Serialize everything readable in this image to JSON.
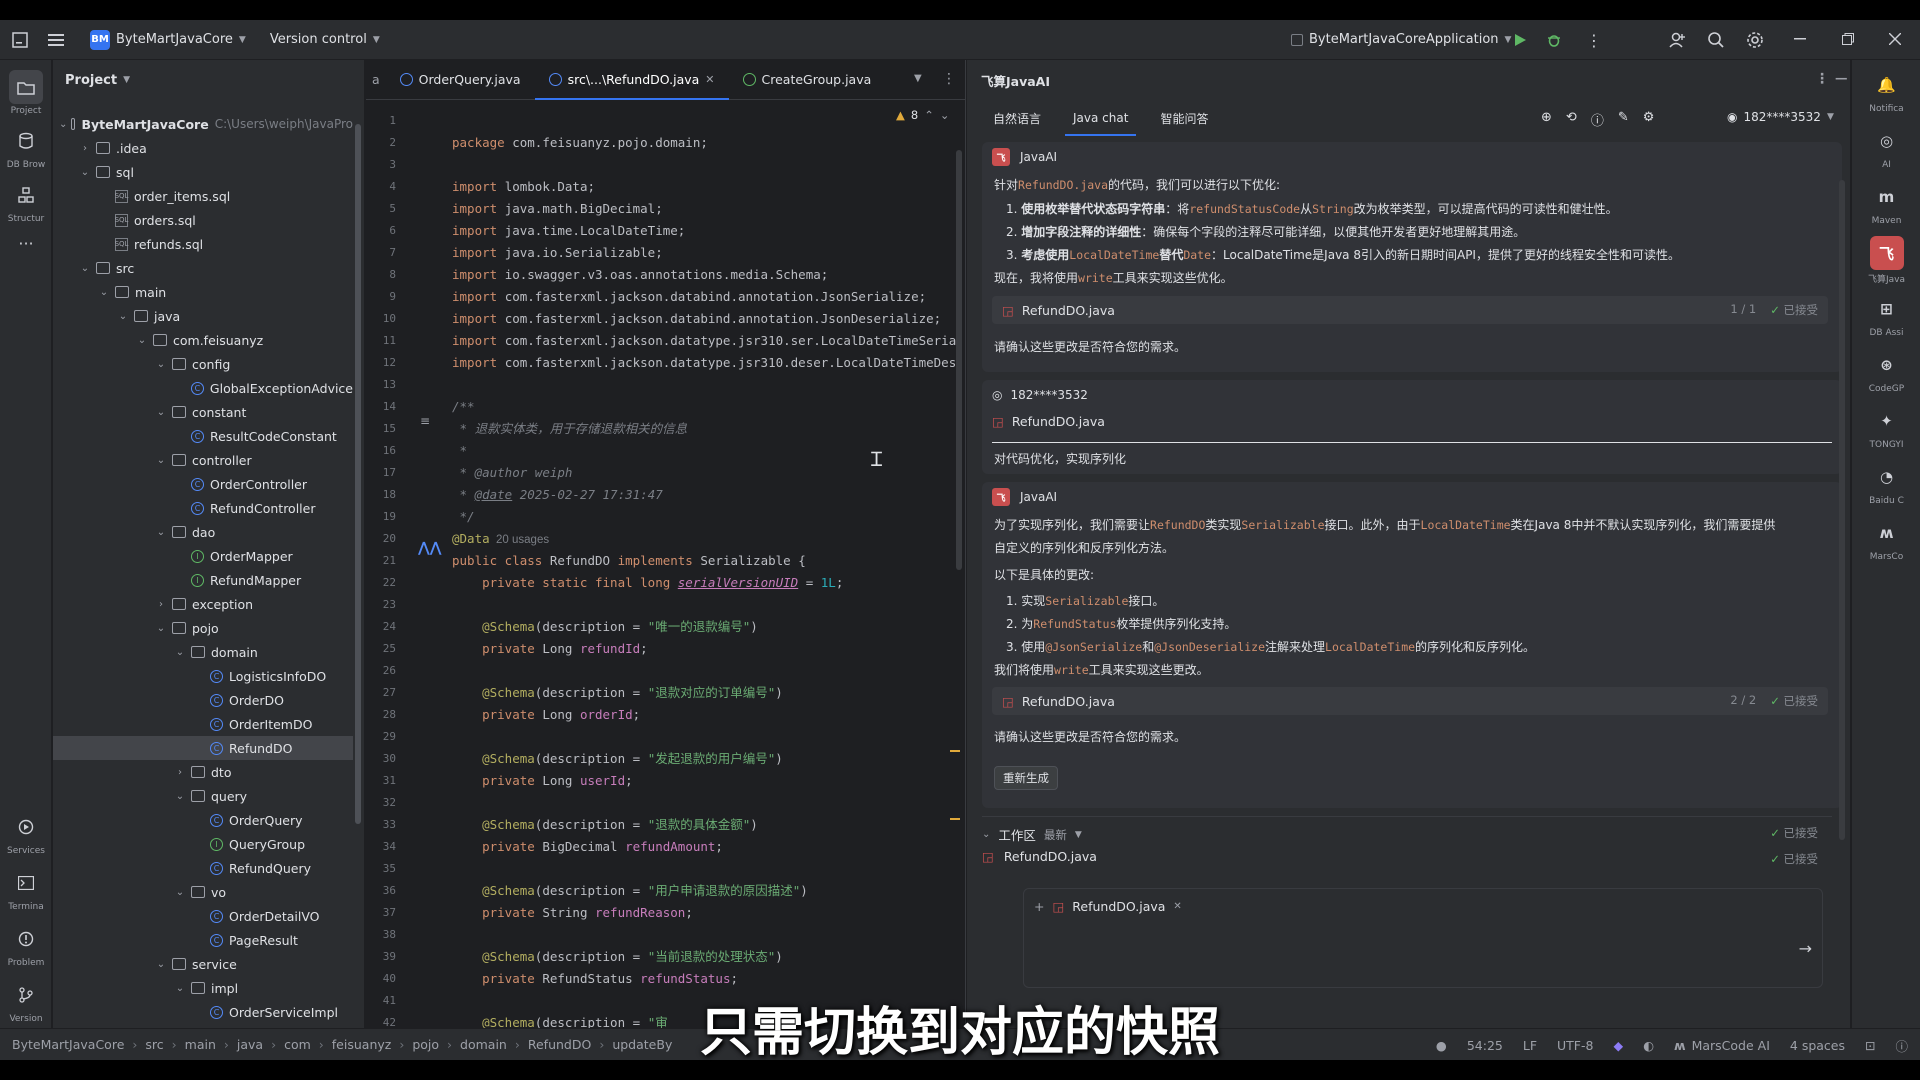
{
  "titlebar": {
    "project_badge": "BM",
    "project_name": "ByteMartJavaCore",
    "vcs": "Version control",
    "run_config": "ByteMartJavaCoreApplication"
  },
  "left_strip": {
    "top": [
      "Project",
      "DB Brow",
      "Structur"
    ],
    "bottom": [
      "Services",
      "Termina",
      "Problem",
      "Version"
    ]
  },
  "project_panel": {
    "title": "Project",
    "tree": [
      {
        "label": "ByteMartJavaCore",
        "path": "C:\\Users\\weiph\\JavaPro",
        "level": 0,
        "type": "folder",
        "open": true,
        "bold": true
      },
      {
        "label": ".idea",
        "level": 1,
        "type": "folder",
        "open": false
      },
      {
        "label": "sql",
        "level": 1,
        "type": "folder",
        "open": true
      },
      {
        "label": "order_items.sql",
        "level": 2,
        "type": "sql"
      },
      {
        "label": "orders.sql",
        "level": 2,
        "type": "sql"
      },
      {
        "label": "refunds.sql",
        "level": 2,
        "type": "sql"
      },
      {
        "label": "src",
        "level": 1,
        "type": "folder",
        "open": true
      },
      {
        "label": "main",
        "level": 2,
        "type": "folder",
        "open": true
      },
      {
        "label": "java",
        "level": 3,
        "type": "folder",
        "open": true
      },
      {
        "label": "com.feisuanyz",
        "level": 4,
        "type": "folder",
        "open": true
      },
      {
        "label": "config",
        "level": 5,
        "type": "folder",
        "open": true
      },
      {
        "label": "GlobalExceptionAdvice",
        "level": 6,
        "type": "class"
      },
      {
        "label": "constant",
        "level": 5,
        "type": "folder",
        "open": true
      },
      {
        "label": "ResultCodeConstant",
        "level": 6,
        "type": "class"
      },
      {
        "label": "controller",
        "level": 5,
        "type": "folder",
        "open": true
      },
      {
        "label": "OrderController",
        "level": 6,
        "type": "class"
      },
      {
        "label": "RefundController",
        "level": 6,
        "type": "class"
      },
      {
        "label": "dao",
        "level": 5,
        "type": "folder",
        "open": true
      },
      {
        "label": "OrderMapper",
        "level": 6,
        "type": "interface"
      },
      {
        "label": "RefundMapper",
        "level": 6,
        "type": "interface"
      },
      {
        "label": "exception",
        "level": 5,
        "type": "folder",
        "open": false
      },
      {
        "label": "pojo",
        "level": 5,
        "type": "folder",
        "open": true
      },
      {
        "label": "domain",
        "level": 6,
        "type": "folder",
        "open": true
      },
      {
        "label": "LogisticsInfoDO",
        "level": 7,
        "type": "class"
      },
      {
        "label": "OrderDO",
        "level": 7,
        "type": "class"
      },
      {
        "label": "OrderItemDO",
        "level": 7,
        "type": "class"
      },
      {
        "label": "RefundDO",
        "level": 7,
        "type": "class",
        "selected": true
      },
      {
        "label": "dto",
        "level": 6,
        "type": "folder",
        "open": false
      },
      {
        "label": "query",
        "level": 6,
        "type": "folder",
        "open": true
      },
      {
        "label": "OrderQuery",
        "level": 7,
        "type": "class"
      },
      {
        "label": "QueryGroup",
        "level": 7,
        "type": "interface"
      },
      {
        "label": "RefundQuery",
        "level": 7,
        "type": "class"
      },
      {
        "label": "vo",
        "level": 6,
        "type": "folder",
        "open": true
      },
      {
        "label": "OrderDetailVO",
        "level": 7,
        "type": "class"
      },
      {
        "label": "PageResult",
        "level": 7,
        "type": "class"
      },
      {
        "label": "service",
        "level": 5,
        "type": "folder",
        "open": true
      },
      {
        "label": "impl",
        "level": 6,
        "type": "folder",
        "open": true
      },
      {
        "label": "OrderServiceImpl",
        "level": 7,
        "type": "class"
      }
    ]
  },
  "editor": {
    "tab_a": "a",
    "tabs": [
      {
        "label": "OrderQuery.java",
        "active": false
      },
      {
        "label": "src\\...\\RefundDO.java",
        "active": true
      },
      {
        "label": "CreateGroup.java",
        "active": false
      }
    ],
    "warnings": "8",
    "line_numbers": [
      "1",
      "2",
      "3",
      "4",
      "5",
      "6",
      "7",
      "8",
      "9",
      "10",
      "11",
      "12",
      "13",
      "14",
      "15",
      "16",
      "17",
      "18",
      "19",
      "20",
      "21",
      "22",
      "23",
      "24",
      "25",
      "26",
      "27",
      "28",
      "29",
      "30",
      "31",
      "32",
      "33",
      "34",
      "35",
      "36",
      "37",
      "38",
      "39",
      "40",
      "41",
      "42"
    ],
    "lines": [
      [],
      [
        {
          "t": "package ",
          "c": "kw"
        },
        {
          "t": "com.feisuanyz.pojo.domain;",
          "c": "plain"
        }
      ],
      [],
      [
        {
          "t": "import ",
          "c": "kw"
        },
        {
          "t": "lombok.Data;",
          "c": "plain"
        }
      ],
      [
        {
          "t": "import ",
          "c": "kw"
        },
        {
          "t": "java.math.BigDecimal;",
          "c": "plain"
        }
      ],
      [
        {
          "t": "import ",
          "c": "kw"
        },
        {
          "t": "java.time.LocalDateTime;",
          "c": "plain"
        }
      ],
      [
        {
          "t": "import ",
          "c": "kw"
        },
        {
          "t": "java.io.Serializable;",
          "c": "plain"
        }
      ],
      [
        {
          "t": "import ",
          "c": "kw"
        },
        {
          "t": "io.swagger.v3.oas.annotations.media.Schema;",
          "c": "plain"
        }
      ],
      [
        {
          "t": "import ",
          "c": "kw"
        },
        {
          "t": "com.fasterxml.jackson.databind.annotation.JsonSerialize;",
          "c": "plain"
        }
      ],
      [
        {
          "t": "import ",
          "c": "kw"
        },
        {
          "t": "com.fasterxml.jackson.databind.annotation.JsonDeserialize;",
          "c": "plain"
        }
      ],
      [
        {
          "t": "import ",
          "c": "kw"
        },
        {
          "t": "com.fasterxml.jackson.datatype.jsr310.ser.LocalDateTimeSerializer;",
          "c": "plain"
        }
      ],
      [
        {
          "t": "import ",
          "c": "kw"
        },
        {
          "t": "com.fasterxml.jackson.datatype.jsr310.deser.LocalDateTimeDeserializer;",
          "c": "plain"
        }
      ],
      [],
      [
        {
          "t": "/**",
          "c": "cm"
        }
      ],
      [
        {
          "t": " * 退款实体类，用于存储退款相关的信息",
          "c": "cm"
        }
      ],
      [
        {
          "t": " *",
          "c": "cm"
        }
      ],
      [
        {
          "t": " * @author ",
          "c": "cm"
        },
        {
          "t": "weiph",
          "c": "cm"
        }
      ],
      [
        {
          "t": " * ",
          "c": "cm"
        },
        {
          "t": "@date",
          "c": "cmtag"
        },
        {
          "t": " 2025-02-27 17:31:47",
          "c": "cm"
        }
      ],
      [
        {
          "t": " */",
          "c": "cm"
        }
      ],
      [
        {
          "t": "@Data",
          "c": "ann"
        },
        {
          "t": "  20 usages",
          "c": "hint"
        }
      ],
      [
        {
          "t": "public class ",
          "c": "kw"
        },
        {
          "t": "RefundDO ",
          "c": "plain"
        },
        {
          "t": "implements ",
          "c": "kw"
        },
        {
          "t": "Serializable {",
          "c": "plain"
        }
      ],
      [
        {
          "t": "    private static final long ",
          "c": "kw"
        },
        {
          "t": "serialVersionUID",
          "c": "ital"
        },
        {
          "t": " = ",
          "c": "plain"
        },
        {
          "t": "1L",
          "c": "num"
        },
        {
          "t": ";",
          "c": "plain"
        }
      ],
      [],
      [
        {
          "t": "    @Schema",
          "c": "ann"
        },
        {
          "t": "(description = ",
          "c": "plain"
        },
        {
          "t": "\"唯一的退款编号\"",
          "c": "str"
        },
        {
          "t": ")",
          "c": "plain"
        }
      ],
      [
        {
          "t": "    private ",
          "c": "kw"
        },
        {
          "t": "Long ",
          "c": "plain"
        },
        {
          "t": "refundId",
          "c": "fld"
        },
        {
          "t": ";",
          "c": "plain"
        }
      ],
      [],
      [
        {
          "t": "    @Schema",
          "c": "ann"
        },
        {
          "t": "(description = ",
          "c": "plain"
        },
        {
          "t": "\"退款对应的订单编号\"",
          "c": "str"
        },
        {
          "t": ")",
          "c": "plain"
        }
      ],
      [
        {
          "t": "    private ",
          "c": "kw"
        },
        {
          "t": "Long ",
          "c": "plain"
        },
        {
          "t": "orderId",
          "c": "fld"
        },
        {
          "t": ";",
          "c": "plain"
        }
      ],
      [],
      [
        {
          "t": "    @Schema",
          "c": "ann"
        },
        {
          "t": "(description = ",
          "c": "plain"
        },
        {
          "t": "\"发起退款的用户编号\"",
          "c": "str"
        },
        {
          "t": ")",
          "c": "plain"
        }
      ],
      [
        {
          "t": "    private ",
          "c": "kw"
        },
        {
          "t": "Long ",
          "c": "plain"
        },
        {
          "t": "userId",
          "c": "fld"
        },
        {
          "t": ";",
          "c": "plain"
        }
      ],
      [],
      [
        {
          "t": "    @Schema",
          "c": "ann"
        },
        {
          "t": "(description = ",
          "c": "plain"
        },
        {
          "t": "\"退款的具体金额\"",
          "c": "str"
        },
        {
          "t": ")",
          "c": "plain"
        }
      ],
      [
        {
          "t": "    private ",
          "c": "kw"
        },
        {
          "t": "BigDecimal ",
          "c": "plain"
        },
        {
          "t": "refundAmount",
          "c": "fld"
        },
        {
          "t": ";",
          "c": "plain"
        }
      ],
      [],
      [
        {
          "t": "    @Schema",
          "c": "ann"
        },
        {
          "t": "(description = ",
          "c": "plain"
        },
        {
          "t": "\"用户申请退款的原因描述\"",
          "c": "str"
        },
        {
          "t": ")",
          "c": "plain"
        }
      ],
      [
        {
          "t": "    private ",
          "c": "kw"
        },
        {
          "t": "String ",
          "c": "plain"
        },
        {
          "t": "refundReason",
          "c": "fld"
        },
        {
          "t": ";",
          "c": "plain"
        }
      ],
      [],
      [
        {
          "t": "    @Schema",
          "c": "ann"
        },
        {
          "t": "(description = ",
          "c": "plain"
        },
        {
          "t": "\"当前退款的处理状态\"",
          "c": "str"
        },
        {
          "t": ")",
          "c": "plain"
        }
      ],
      [
        {
          "t": "    private ",
          "c": "kw"
        },
        {
          "t": "RefundStatus ",
          "c": "plain"
        },
        {
          "t": "refundStatus",
          "c": "fld"
        },
        {
          "t": ";",
          "c": "plain"
        }
      ],
      [],
      [
        {
          "t": "    @Schema",
          "c": "ann"
        },
        {
          "t": "(description = ",
          "c": "plain"
        },
        {
          "t": "\"审",
          "c": "str"
        }
      ]
    ]
  },
  "chat": {
    "title": "飞算JavaAI",
    "tabs": [
      "自然语言",
      "Java chat",
      "智能问答"
    ],
    "active_tab": 1,
    "user": "182****3532",
    "ai_name": "JavaAI",
    "msg1": {
      "intro_a": "针对",
      "intro_code": "RefundDO.java",
      "intro_b": "的代码，我们可以进行以下优化:",
      "items": [
        {
          "n": "1.",
          "bold": "使用枚举替代状态码字符串",
          "a": "：将",
          "c1": "refundStatusCode",
          "b": "从",
          "c2": "String",
          "rest": "改为枚举类型，可以提高代码的可读性和健壮性。"
        },
        {
          "n": "2.",
          "bold": "增加字段注释的详细性",
          "a": "：确保每个字段的注释尽可能详细，以便其他开发者更好地理解其用途。",
          "c1": "",
          "b": "",
          "c2": "",
          "rest": ""
        },
        {
          "n": "3.",
          "bold": "考虑使用",
          "a": "",
          "c1": "LocalDateTime",
          "b": "替代",
          "c2": "Date",
          "rest": "：LocalDateTime是Java 8引入的新日期时间API，提供了更好的线程安全性和可读性。"
        }
      ],
      "now_a": "现在，我将使用",
      "now_code": "write",
      "now_b": "工具来实现这些优化。",
      "file": "RefundDO.java",
      "file_count": "1 / 1",
      "file_status": "已接受",
      "confirm": "请确认这些更改是否符合您的需求。"
    },
    "user_msg": {
      "file": "RefundDO.java",
      "text": "对代码优化，实现序列化"
    },
    "msg2": {
      "line1_a": "为了实现序列化，我们需要让",
      "line1_c1": "RefundDO",
      "line1_b": "类实现",
      "line1_c2": "Serializable",
      "line1_c": "接口。此外，由于",
      "line1_c3": "LocalDateTime",
      "line1_d": "类在Java 8中并不默认实现序列化，我们需要提供",
      "line2": "自定义的序列化和反序列化方法。",
      "line3": "以下是具体的更改:",
      "i1_a": "实现",
      "i1_c": "Serializable",
      "i1_b": "接口。",
      "i2_a": "为",
      "i2_c": "RefundStatus",
      "i2_b": "枚举提供序列化支持。",
      "i3_a": "使用",
      "i3_c1": "@JsonSerialize",
      "i3_b": "和",
      "i3_c2": "@JsonDeserialize",
      "i3_c": "注解来处理",
      "i3_c3": "LocalDateTime",
      "i3_d": "的序列化和反序列化。",
      "use_a": "我们将使用",
      "use_c": "write",
      "use_b": "工具来实现这些更改。",
      "file": "RefundDO.java",
      "file_count": "2 / 2",
      "file_status": "已接受",
      "confirm": "请确认这些更改是否符合您的需求。",
      "regen": "重新生成"
    },
    "workspace": {
      "label": "工作区",
      "sort": "最新",
      "status": "已接受",
      "file": "RefundDO.java",
      "file_status": "已接受"
    },
    "input_chip": "RefundDO.java"
  },
  "right_strip": [
    "Notifica",
    "AI",
    "Maven",
    "飞算Java",
    "DB Assi",
    "CodeGP",
    "TONGYI",
    "Baidu C",
    "MarsCo"
  ],
  "statusbar": {
    "crumbs": [
      "ByteMartJavaCore",
      "src",
      "main",
      "java",
      "com",
      "feisuanyz",
      "pojo",
      "domain",
      "RefundDO",
      "updateBy"
    ],
    "position": "54:25",
    "line_sep": "LF",
    "encoding": "UTF-8",
    "plugin": "MarsCode AI",
    "indent": "4 spaces"
  },
  "subtitle": "只需切换到对应的快照"
}
